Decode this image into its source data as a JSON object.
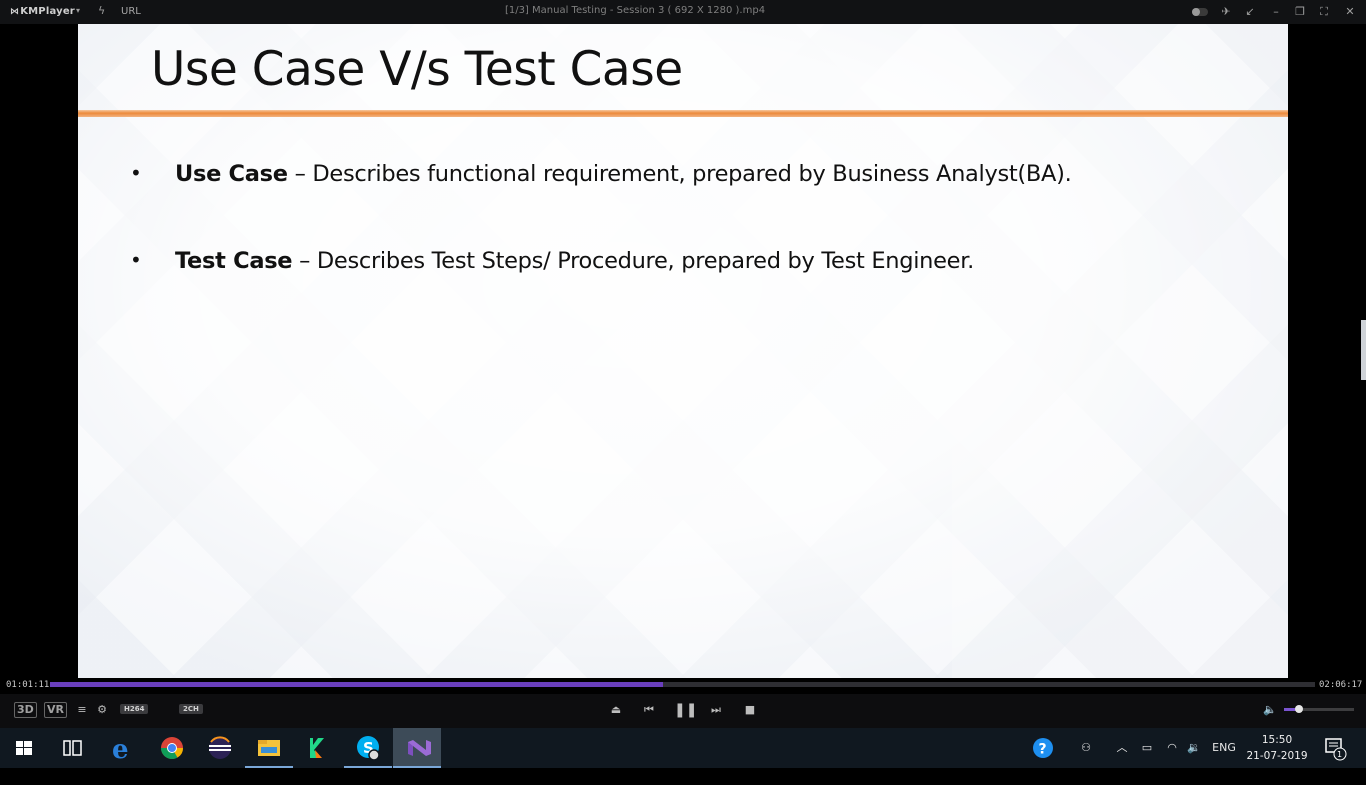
{
  "titlebar": {
    "app_name": "KMPlayer",
    "url_label": "URL",
    "window_title": "[1/3] Manual Testing - Session 3 ( 692 X 1280 ).mp4"
  },
  "slide": {
    "title": "Use Case V/s Test Case",
    "bullets": [
      {
        "term": "Use Case",
        "text": " – Describes functional requirement, prepared by Business Analyst(BA)."
      },
      {
        "term": "Test Case",
        "text": " – Describes Test Steps/ Procedure, prepared by Test Engineer."
      }
    ],
    "accent_color": "#ec8a3c"
  },
  "player": {
    "elapsed": "01:01:11",
    "duration": "02:06:17",
    "progress_fraction": 0.4846,
    "volume_fraction": 0.22,
    "seek_color": "#6a3fbd",
    "badges": {
      "three_d": "3D",
      "vr": "VR",
      "codec": "H264",
      "channels": "2CH"
    },
    "icons": [
      "playlist-icon",
      "settings-icon",
      "eject-icon",
      "previous-icon",
      "pause-icon",
      "next-icon",
      "stop-icon",
      "volume-icon"
    ]
  },
  "taskbar": {
    "apps": [
      "windows-start",
      "task-view",
      "edge",
      "chrome",
      "eclipse",
      "file-explorer",
      "kotlin-app",
      "skype",
      "visual-studio"
    ],
    "language": "ENG",
    "time": "15:50",
    "date": "21-07-2019",
    "notification_count": "1"
  }
}
